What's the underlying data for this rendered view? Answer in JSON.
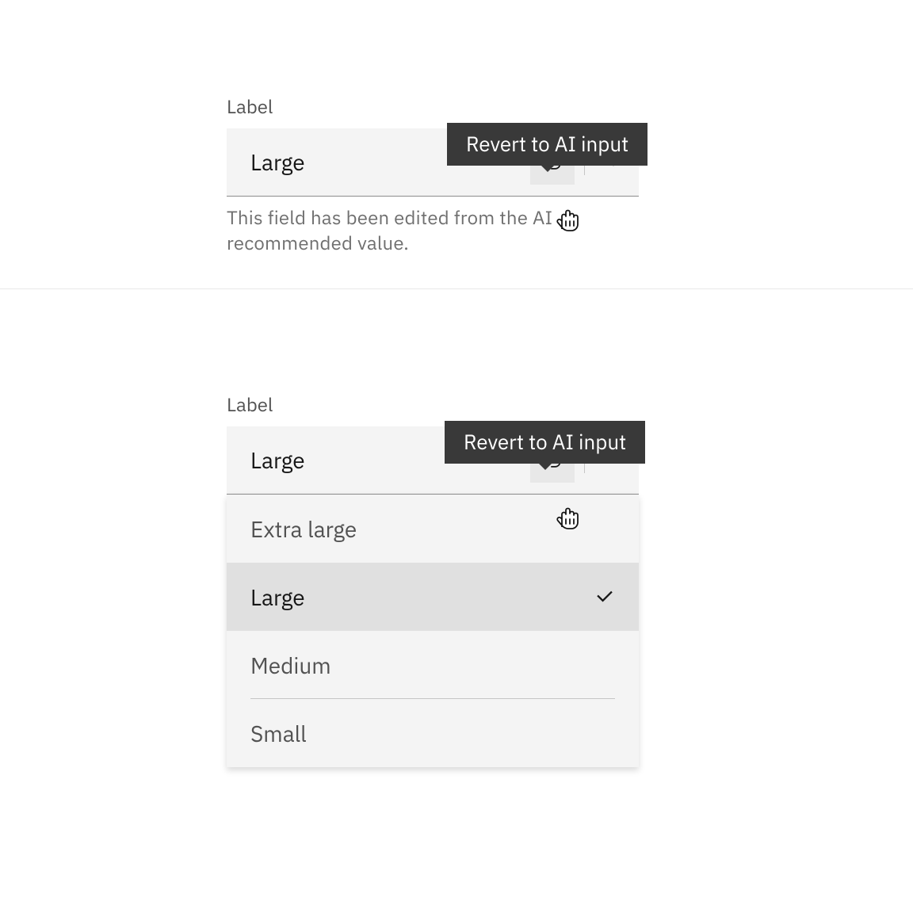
{
  "section1": {
    "label": "Label",
    "value": "Large",
    "tooltip": "Revert to AI input",
    "helper": "This field has been edited from the AI recommended value."
  },
  "section2": {
    "label": "Label",
    "value": "Large",
    "tooltip": "Revert to AI input",
    "options": [
      {
        "label": "Extra large",
        "selected": false
      },
      {
        "label": "Large",
        "selected": true
      },
      {
        "label": "Medium",
        "selected": false
      },
      {
        "label": "Small",
        "selected": false
      }
    ]
  }
}
